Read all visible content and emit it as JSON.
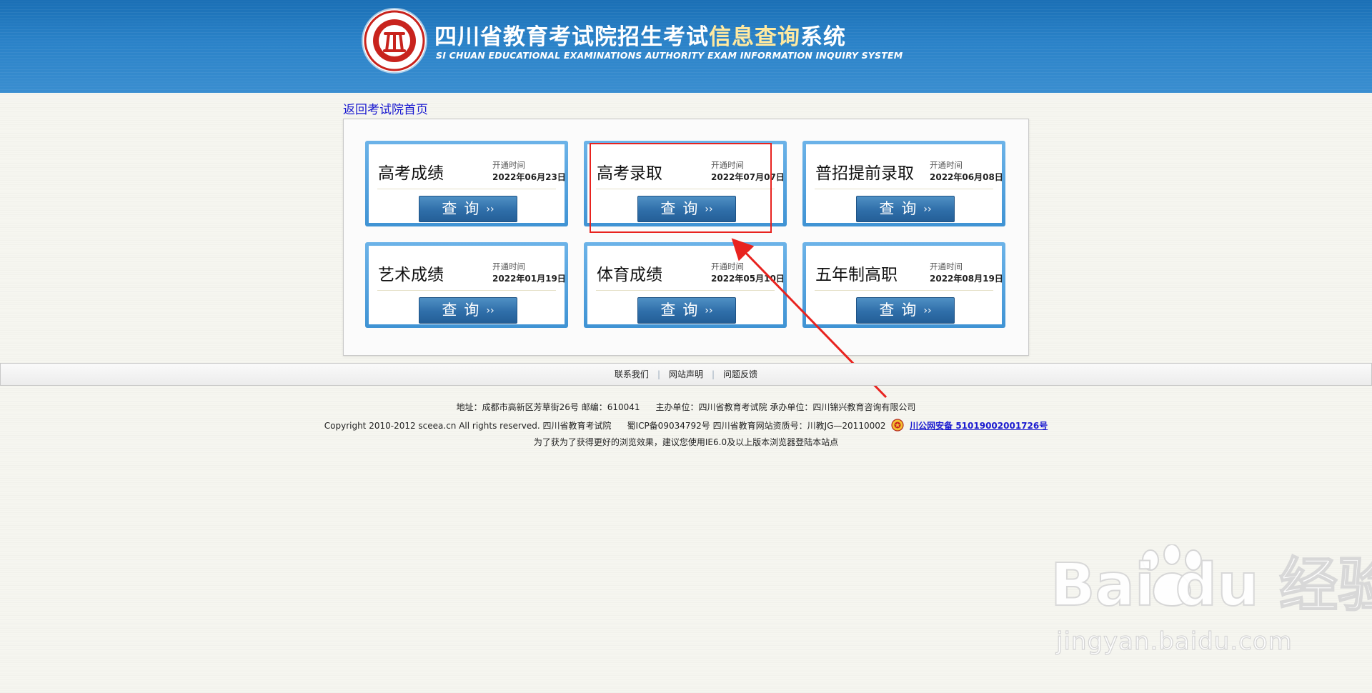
{
  "header": {
    "title_main": "四川省教育考试院招生考试",
    "title_highlight": "信息查询",
    "title_tail": "系统",
    "title_en": "SI CHUAN EDUCATIONAL EXAMINATIONS AUTHORITY EXAM INFORMATION INQUIRY SYSTEM",
    "logo_icon": "sceea-logo-icon"
  },
  "back_link": "返回考试院首页",
  "open_label": "开通时间",
  "query_label": "查询",
  "query_arrow": "››",
  "cards": [
    {
      "title": "高考成绩",
      "open_label": "开通时间",
      "date": "2022年06月23日",
      "btn": "查询"
    },
    {
      "title": "高考录取",
      "open_label": "开通时间",
      "date": "2022年07月07日",
      "btn": "查询"
    },
    {
      "title": "普招提前录取",
      "open_label": "开通时间",
      "date": "2022年06月08日",
      "btn": "查询"
    },
    {
      "title": "艺术成绩",
      "open_label": "开通时间",
      "date": "2022年01月19日",
      "btn": "查询"
    },
    {
      "title": "体育成绩",
      "open_label": "开通时间",
      "date": "2022年05月10日",
      "btn": "查询"
    },
    {
      "title": "五年制高职",
      "open_label": "开通时间",
      "date": "2022年08月19日",
      "btn": "查询"
    }
  ],
  "footer": {
    "nav": [
      "联系我们",
      "网站声明",
      "问题反馈"
    ],
    "address": "地址：成都市高新区芳草街26号 邮编：610041",
    "host": "主办单位：四川省教育考试院 承办单位：四川锦兴教育咨询有限公司",
    "copyright": "Copyright 2010-2012 sceea.cn All rights reserved. 四川省教育考试院",
    "icp": "蜀ICP备09034792号 四川省教育网站资质号：川教JG—20110002",
    "beian": "川公网安备 51019002001726号",
    "browser_tip": "为了获为了获得更好的浏览效果，建议您使用IE6.0及以上版本浏览器登陆本站点"
  },
  "watermark": {
    "main": "Bai  du 经验",
    "sub": "jingyan.baidu.com"
  },
  "colors": {
    "header_blue": "#2a82c8",
    "card_border": "#4f9fdd",
    "button_blue": "#2f6ea9",
    "highlight_red": "#e8231f",
    "link_blue": "#1a1ad0"
  }
}
